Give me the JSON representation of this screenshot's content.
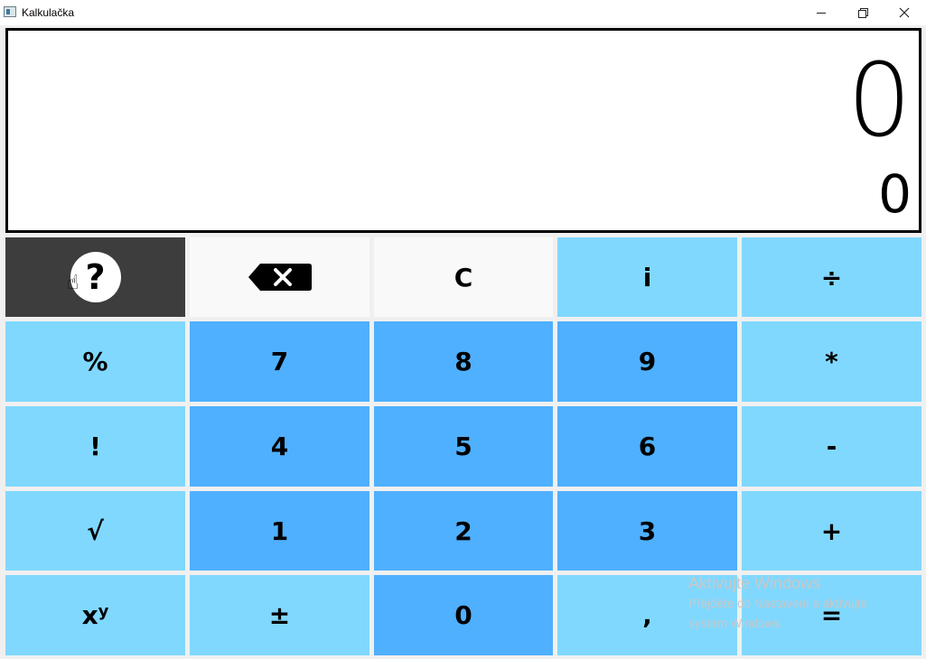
{
  "window": {
    "title": "Kalkulačka",
    "controls": {
      "minimize": "—",
      "restore": "❐",
      "close": "✕"
    }
  },
  "display": {
    "main_value": "0",
    "secondary_value": "0"
  },
  "buttons": [
    {
      "id": "help",
      "label": "?",
      "style": "dark",
      "icon": "help-icon"
    },
    {
      "id": "backspace",
      "label": "",
      "style": "white",
      "icon": "backspace-icon"
    },
    {
      "id": "clear",
      "label": "C",
      "style": "white"
    },
    {
      "id": "info",
      "label": "i",
      "style": "light"
    },
    {
      "id": "divide",
      "label": "÷",
      "style": "light"
    },
    {
      "id": "percent",
      "label": "%",
      "style": "light"
    },
    {
      "id": "seven",
      "label": "7",
      "style": "mid"
    },
    {
      "id": "eight",
      "label": "8",
      "style": "mid"
    },
    {
      "id": "nine",
      "label": "9",
      "style": "mid"
    },
    {
      "id": "multiply",
      "label": "*",
      "style": "light"
    },
    {
      "id": "factorial",
      "label": "!",
      "style": "light"
    },
    {
      "id": "four",
      "label": "4",
      "style": "mid"
    },
    {
      "id": "five",
      "label": "5",
      "style": "mid"
    },
    {
      "id": "six",
      "label": "6",
      "style": "mid"
    },
    {
      "id": "subtract",
      "label": "-",
      "style": "light"
    },
    {
      "id": "sqrt",
      "label": "√",
      "style": "light"
    },
    {
      "id": "one",
      "label": "1",
      "style": "mid"
    },
    {
      "id": "two",
      "label": "2",
      "style": "mid"
    },
    {
      "id": "three",
      "label": "3",
      "style": "mid"
    },
    {
      "id": "add",
      "label": "+",
      "style": "light"
    },
    {
      "id": "power",
      "label": "x",
      "sup": "y",
      "style": "light"
    },
    {
      "id": "negate",
      "label": "±",
      "style": "light"
    },
    {
      "id": "zero",
      "label": "0",
      "style": "mid"
    },
    {
      "id": "comma",
      "label": ",",
      "style": "light"
    },
    {
      "id": "equals",
      "label": "=",
      "style": "light"
    }
  ],
  "watermark": {
    "title": "Aktivujte Windows",
    "line1": "Přejděte do Nastavení a aktivujte",
    "line2": "systém Windows."
  },
  "colors": {
    "light_button": "#80d8ff",
    "mid_button": "#4fb0ff",
    "white_button": "#f9f9f9",
    "dark_button": "#3d3d3d"
  }
}
